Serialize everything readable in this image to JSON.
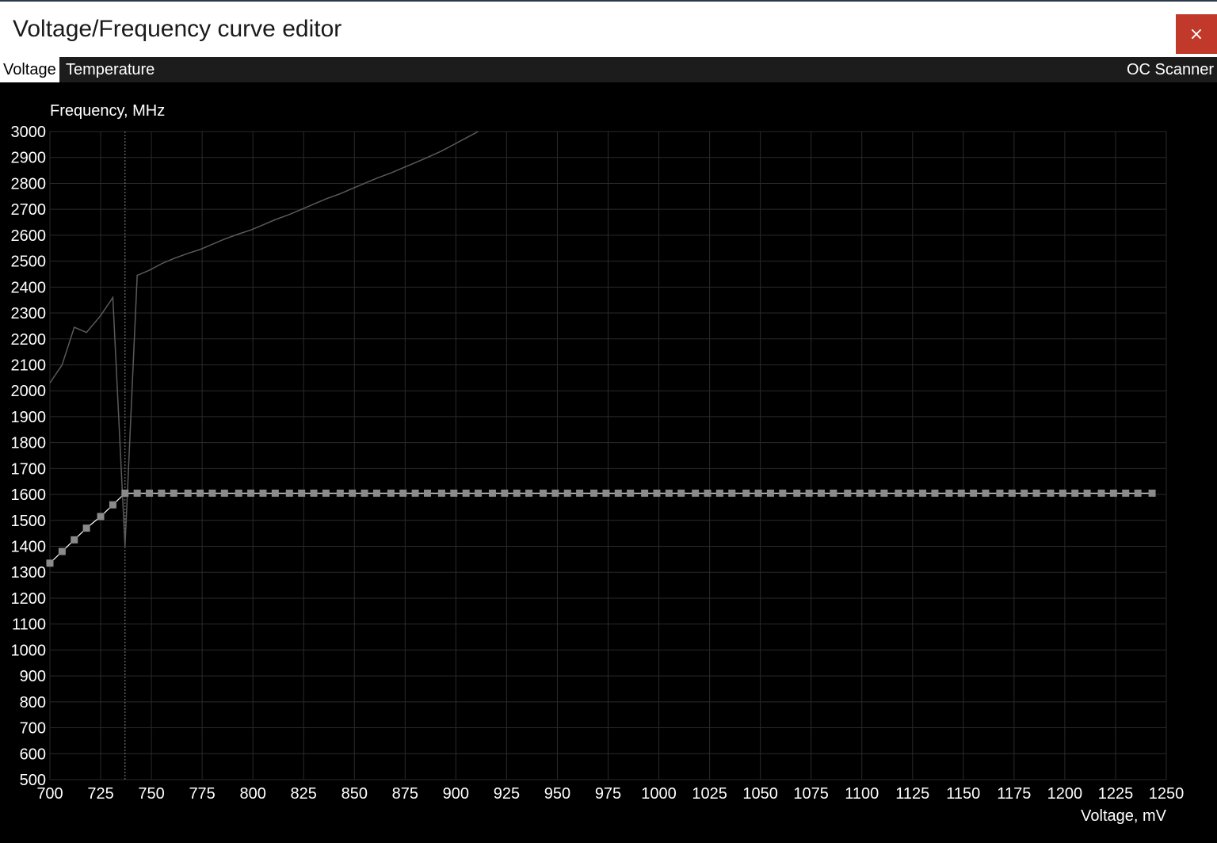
{
  "window": {
    "title": "Voltage/Frequency curve editor",
    "close_glyph": "×"
  },
  "tabs": {
    "voltage": "Voltage",
    "temperature": "Temperature",
    "oc_scanner": "OC Scanner"
  },
  "colors": {
    "background": "#000000",
    "grid": "#2a2a2a",
    "curve": "#ffffff",
    "point": "#8a8a8a",
    "reference": "#5a5a5a",
    "close_button": "#c0392b"
  },
  "chart_data": {
    "type": "line",
    "ylabel": "Frequency, MHz",
    "xlabel": "Voltage, mV",
    "xlim": [
      700,
      1250
    ],
    "ylim": [
      500,
      3000
    ],
    "x_ticks": [
      700,
      725,
      750,
      775,
      800,
      825,
      850,
      875,
      900,
      925,
      950,
      975,
      1000,
      1025,
      1050,
      1075,
      1100,
      1125,
      1150,
      1175,
      1200,
      1225,
      1250
    ],
    "y_ticks": [
      3000,
      2900,
      2800,
      2700,
      2600,
      2500,
      2400,
      2300,
      2200,
      2100,
      2000,
      1900,
      1800,
      1700,
      1600,
      1500,
      1400,
      1300,
      1200,
      1100,
      1000,
      900,
      800,
      700,
      600,
      500
    ],
    "grid": true,
    "selected_voltage_mV": 737,
    "series": [
      {
        "role": "curve_points",
        "points": [
          [
            700,
            1335
          ],
          [
            706,
            1380
          ],
          [
            712,
            1425
          ],
          [
            718,
            1470
          ],
          [
            725,
            1515
          ],
          [
            731,
            1560
          ],
          [
            737,
            1605
          ],
          [
            743,
            1605
          ],
          [
            749,
            1605
          ],
          [
            755,
            1605
          ],
          [
            761,
            1605
          ],
          [
            768,
            1605
          ],
          [
            774,
            1605
          ],
          [
            780,
            1605
          ],
          [
            786,
            1605
          ],
          [
            793,
            1605
          ],
          [
            799,
            1605
          ],
          [
            805,
            1605
          ],
          [
            811,
            1605
          ],
          [
            818,
            1605
          ],
          [
            824,
            1605
          ],
          [
            830,
            1605
          ],
          [
            836,
            1605
          ],
          [
            843,
            1605
          ],
          [
            849,
            1605
          ],
          [
            855,
            1605
          ],
          [
            861,
            1605
          ],
          [
            868,
            1605
          ],
          [
            874,
            1605
          ],
          [
            880,
            1605
          ],
          [
            886,
            1605
          ],
          [
            893,
            1605
          ],
          [
            899,
            1605
          ],
          [
            905,
            1605
          ],
          [
            911,
            1605
          ],
          [
            918,
            1605
          ],
          [
            924,
            1605
          ],
          [
            930,
            1605
          ],
          [
            936,
            1605
          ],
          [
            943,
            1605
          ],
          [
            949,
            1605
          ],
          [
            955,
            1605
          ],
          [
            961,
            1605
          ],
          [
            968,
            1605
          ],
          [
            974,
            1605
          ],
          [
            980,
            1605
          ],
          [
            986,
            1605
          ],
          [
            993,
            1605
          ],
          [
            999,
            1605
          ],
          [
            1005,
            1605
          ],
          [
            1011,
            1605
          ],
          [
            1018,
            1605
          ],
          [
            1024,
            1605
          ],
          [
            1030,
            1605
          ],
          [
            1036,
            1605
          ],
          [
            1043,
            1605
          ],
          [
            1049,
            1605
          ],
          [
            1055,
            1605
          ],
          [
            1061,
            1605
          ],
          [
            1068,
            1605
          ],
          [
            1074,
            1605
          ],
          [
            1080,
            1605
          ],
          [
            1086,
            1605
          ],
          [
            1093,
            1605
          ],
          [
            1099,
            1605
          ],
          [
            1105,
            1605
          ],
          [
            1111,
            1605
          ],
          [
            1118,
            1605
          ],
          [
            1124,
            1605
          ],
          [
            1130,
            1605
          ],
          [
            1136,
            1605
          ],
          [
            1143,
            1605
          ],
          [
            1149,
            1605
          ],
          [
            1155,
            1605
          ],
          [
            1161,
            1605
          ],
          [
            1168,
            1605
          ],
          [
            1174,
            1605
          ],
          [
            1180,
            1605
          ],
          [
            1186,
            1605
          ],
          [
            1193,
            1605
          ],
          [
            1199,
            1605
          ],
          [
            1205,
            1605
          ],
          [
            1211,
            1605
          ],
          [
            1218,
            1605
          ],
          [
            1224,
            1605
          ],
          [
            1230,
            1605
          ],
          [
            1236,
            1605
          ],
          [
            1243,
            1605
          ]
        ]
      },
      {
        "role": "reference_curve",
        "points": [
          [
            700,
            2030
          ],
          [
            706,
            2100
          ],
          [
            712,
            2245
          ],
          [
            718,
            2225
          ],
          [
            725,
            2290
          ],
          [
            731,
            2360
          ],
          [
            737,
            1400
          ],
          [
            743,
            2445
          ],
          [
            749,
            2465
          ],
          [
            755,
            2490
          ],
          [
            761,
            2510
          ],
          [
            768,
            2530
          ],
          [
            774,
            2545
          ],
          [
            780,
            2565
          ],
          [
            786,
            2585
          ],
          [
            793,
            2605
          ],
          [
            799,
            2620
          ],
          [
            805,
            2640
          ],
          [
            811,
            2660
          ],
          [
            818,
            2680
          ],
          [
            824,
            2700
          ],
          [
            830,
            2720
          ],
          [
            836,
            2740
          ],
          [
            843,
            2760
          ],
          [
            849,
            2780
          ],
          [
            855,
            2800
          ],
          [
            861,
            2820
          ],
          [
            868,
            2840
          ],
          [
            874,
            2860
          ],
          [
            880,
            2880
          ],
          [
            886,
            2900
          ],
          [
            893,
            2925
          ],
          [
            899,
            2950
          ],
          [
            905,
            2975
          ],
          [
            911,
            3000
          ]
        ]
      }
    ]
  }
}
